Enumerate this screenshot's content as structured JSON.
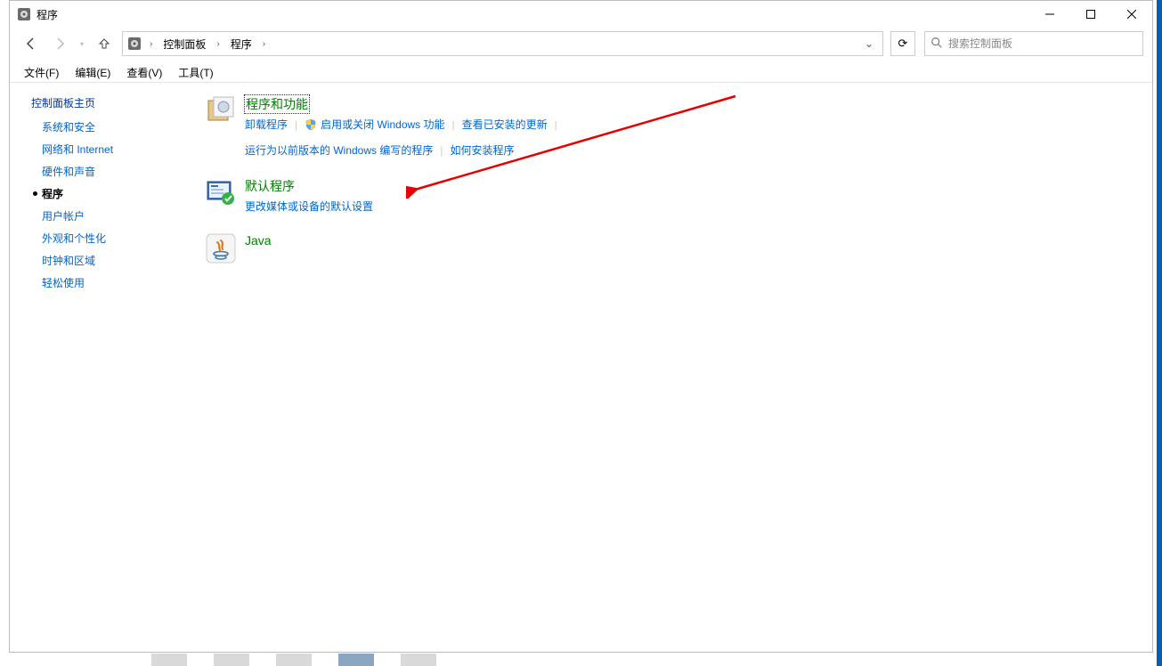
{
  "window": {
    "title": "程序"
  },
  "breadcrumb": {
    "root": "控制面板",
    "current": "程序"
  },
  "search": {
    "placeholder": "搜索控制面板"
  },
  "menu": {
    "file": "文件(F)",
    "edit": "编辑(E)",
    "view": "查看(V)",
    "tools": "工具(T)"
  },
  "sidebar": {
    "home": "控制面板主页",
    "items": [
      {
        "label": "系统和安全"
      },
      {
        "label": "网络和 Internet"
      },
      {
        "label": "硬件和声音"
      },
      {
        "label": "程序",
        "current": true
      },
      {
        "label": "用户帐户"
      },
      {
        "label": "外观和个性化"
      },
      {
        "label": "时钟和区域"
      },
      {
        "label": "轻松使用"
      }
    ]
  },
  "categories": {
    "programs": {
      "title": "程序和功能",
      "links": {
        "uninstall": "卸载程序",
        "features": "启用或关闭 Windows 功能",
        "updates": "查看已安装的更新",
        "compat": "运行为以前版本的 Windows 编写的程序",
        "howto": "如何安装程序"
      }
    },
    "defaults": {
      "title": "默认程序",
      "links": {
        "media": "更改媒体或设备的默认设置"
      }
    },
    "java": {
      "title": "Java"
    }
  }
}
